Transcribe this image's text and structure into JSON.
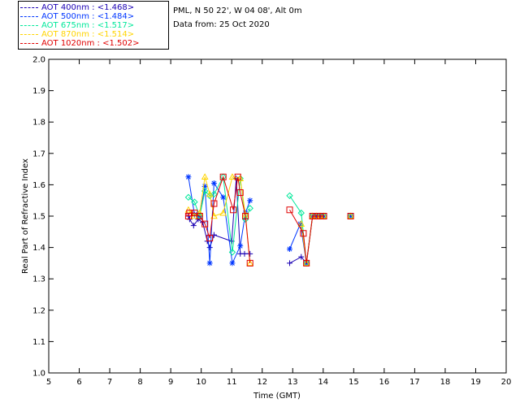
{
  "info": {
    "location": "PML, N 50 22', W 04 08', Alt 0m",
    "date": "Data from: 25 Oct 2020"
  },
  "legend": [
    {
      "label": "AOT  400nm : <1.468>",
      "color": "#1a00b4"
    },
    {
      "label": "AOT  500nm : <1.484>",
      "color": "#0036ff"
    },
    {
      "label": "AOT  675nm : <1.517>",
      "color": "#00e89a"
    },
    {
      "label": "AOT  870nm : <1.514>",
      "color": "#ffd400"
    },
    {
      "label": "AOT 1020nm : <1.502>",
      "color": "#e00000"
    }
  ],
  "chart_data": {
    "type": "scatter",
    "xlabel": "Time (GMT)",
    "ylabel": "Real Part of Refractive Index",
    "xlim": [
      5,
      20
    ],
    "ylim": [
      1.0,
      2.0
    ],
    "xticks": [
      5,
      6,
      7,
      8,
      9,
      10,
      11,
      12,
      13,
      14,
      15,
      16,
      17,
      18,
      19,
      20
    ],
    "yticks": [
      1.0,
      1.1,
      1.2,
      1.3,
      1.4,
      1.5,
      1.6,
      1.7,
      1.8,
      1.9,
      2.0
    ],
    "series": [
      {
        "name": "AOT  400nm",
        "marker": "plus",
        "color": "#1a00b4",
        "x": [
          9.58,
          9.62,
          9.75,
          9.9,
          10.05,
          10.2,
          10.28,
          10.42,
          11.0,
          11.15,
          11.28,
          11.42,
          11.6,
          12.9,
          13.28,
          13.45,
          13.65,
          13.78,
          13.9,
          14.02,
          14.9
        ],
        "y": [
          1.5,
          1.49,
          1.47,
          1.49,
          1.48,
          1.42,
          1.4,
          1.44,
          1.42,
          1.62,
          1.38,
          1.38,
          1.38,
          1.35,
          1.37,
          1.35,
          1.5,
          1.5,
          1.5,
          1.5,
          1.5
        ]
      },
      {
        "name": "AOT  500nm",
        "marker": "asterisk",
        "color": "#0036ff",
        "x": [
          9.58,
          9.78,
          9.95,
          10.12,
          10.28,
          10.42,
          10.72,
          11.02,
          11.28,
          11.45,
          11.6,
          12.9,
          13.25,
          13.45,
          13.65,
          13.78,
          13.9,
          14.02,
          14.9
        ],
        "y": [
          1.625,
          1.505,
          1.5,
          1.595,
          1.35,
          1.605,
          1.56,
          1.35,
          1.405,
          1.51,
          1.55,
          1.395,
          1.475,
          1.35,
          1.5,
          1.5,
          1.5,
          1.5,
          1.5
        ]
      },
      {
        "name": "AOT  675nm",
        "marker": "diamond",
        "color": "#00e89a",
        "x": [
          9.58,
          9.78,
          9.95,
          10.12,
          10.28,
          10.42,
          10.72,
          11.02,
          11.28,
          11.45,
          11.6,
          12.9,
          13.28,
          13.45,
          13.65,
          13.78,
          13.9,
          14.02,
          14.9
        ],
        "y": [
          1.56,
          1.545,
          1.5,
          1.58,
          1.565,
          1.57,
          1.625,
          1.385,
          1.62,
          1.49,
          1.525,
          1.565,
          1.51,
          1.35,
          1.5,
          1.5,
          1.5,
          1.5,
          1.5
        ]
      },
      {
        "name": "AOT  870nm",
        "marker": "triangle",
        "color": "#ffd400",
        "x": [
          9.58,
          9.78,
          9.95,
          10.12,
          10.28,
          10.42,
          10.72,
          11.02,
          11.28,
          11.45,
          11.6,
          13.28,
          13.45,
          13.65,
          13.78,
          13.9,
          14.02,
          14.9
        ],
        "y": [
          1.52,
          1.5,
          1.51,
          1.625,
          1.57,
          1.5,
          1.51,
          1.625,
          1.62,
          1.505,
          1.35,
          1.475,
          1.35,
          1.5,
          1.5,
          1.5,
          1.5,
          1.5
        ]
      },
      {
        "name": "AOT 1020nm",
        "marker": "square",
        "color": "#e00000",
        "x": [
          9.58,
          9.62,
          9.78,
          9.95,
          10.12,
          10.28,
          10.42,
          10.72,
          11.05,
          11.2,
          11.28,
          11.45,
          11.6,
          12.9,
          13.35,
          13.45,
          13.65,
          13.78,
          13.9,
          14.02,
          14.9
        ],
        "y": [
          1.5,
          1.51,
          1.51,
          1.5,
          1.475,
          1.43,
          1.54,
          1.625,
          1.52,
          1.625,
          1.575,
          1.5,
          1.35,
          1.52,
          1.445,
          1.35,
          1.5,
          1.5,
          1.5,
          1.5,
          1.5
        ]
      }
    ]
  }
}
